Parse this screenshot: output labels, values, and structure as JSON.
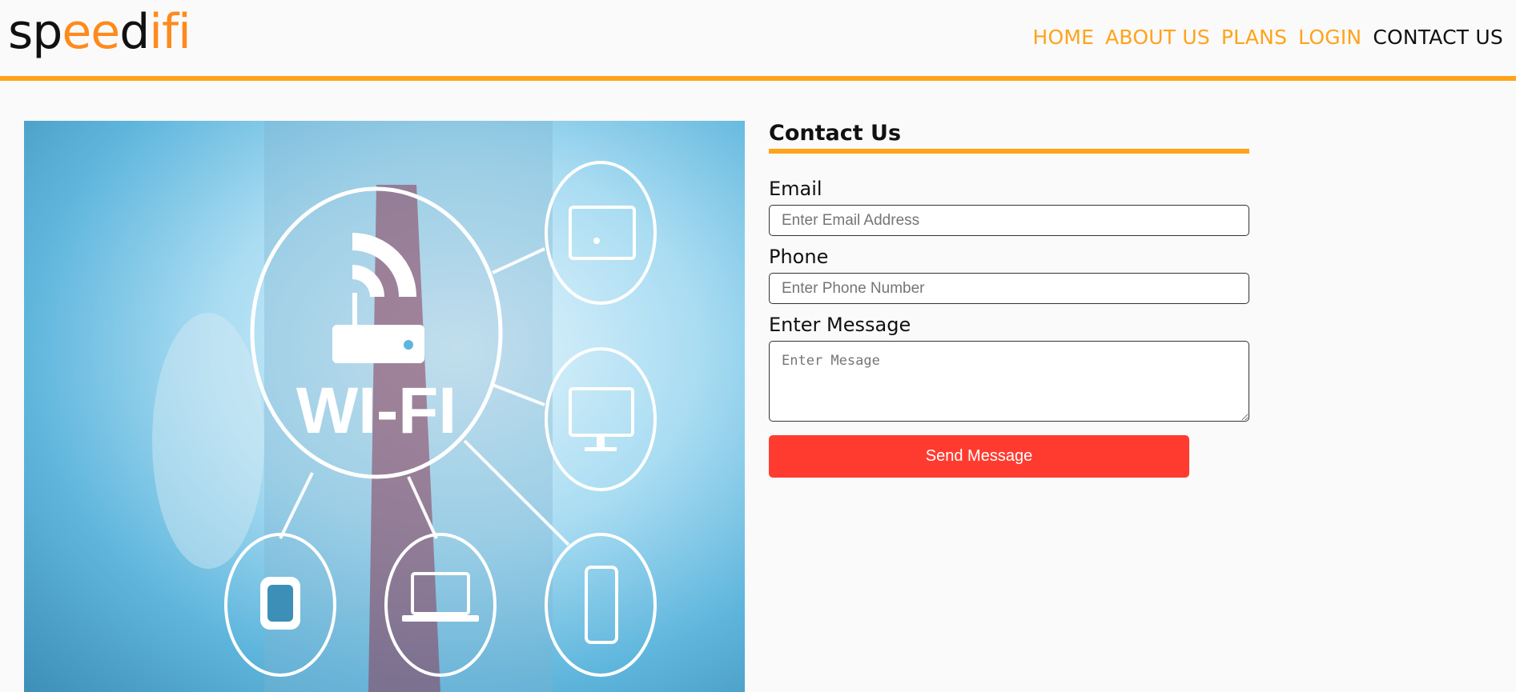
{
  "brand": {
    "logo_part1": "sp",
    "logo_part2": "ee",
    "logo_part3": "d",
    "logo_part4": "ifi"
  },
  "nav": {
    "items": [
      {
        "label": "HOME",
        "active": false
      },
      {
        "label": "ABOUT US",
        "active": false
      },
      {
        "label": "PLANS",
        "active": false
      },
      {
        "label": "LOGIN",
        "active": false
      },
      {
        "label": "CONTACT US",
        "active": true
      }
    ]
  },
  "hero": {
    "text": "WI-FI"
  },
  "form": {
    "title": "Contact Us",
    "email_label": "Email",
    "email_placeholder": "Enter Email Address",
    "phone_label": "Phone",
    "phone_placeholder": "Enter Phone Number",
    "message_label": "Enter Message",
    "message_placeholder": "Enter Mesage",
    "submit_label": "Send Message"
  },
  "colors": {
    "accent": "#ffa31a",
    "button": "#ff3b2f",
    "background": "#fafafa"
  }
}
